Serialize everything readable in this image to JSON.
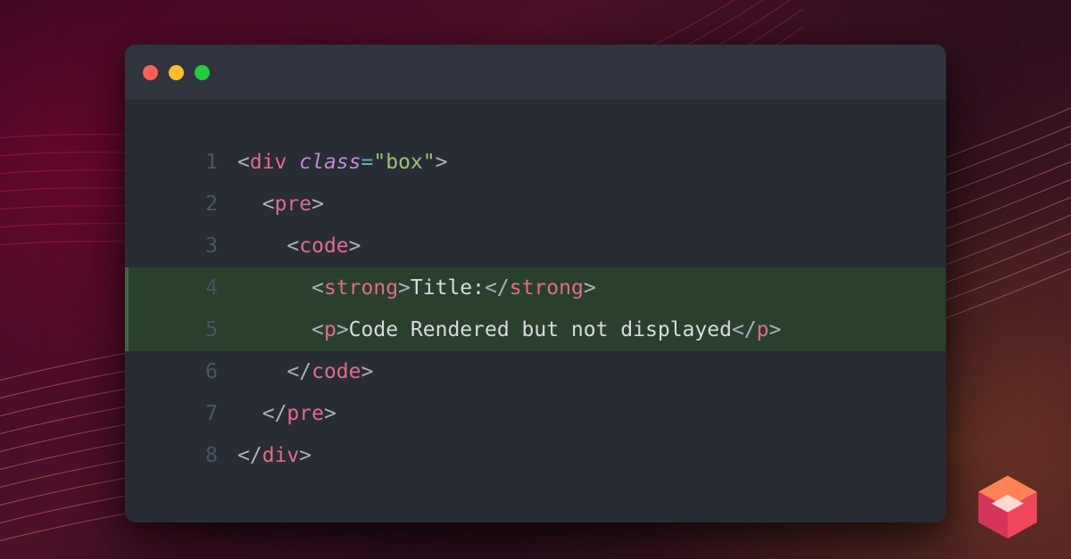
{
  "editor": {
    "traffic_lights": [
      "close",
      "minimize",
      "maximize"
    ],
    "line_numbers": [
      "1",
      "2",
      "3",
      "4",
      "5",
      "6",
      "7",
      "8"
    ],
    "highlighted_lines": [
      4,
      5
    ],
    "lines": [
      {
        "indent": 0,
        "open": true,
        "tag": "div",
        "attr": "class",
        "value": "\"box\"",
        "close_slash": false
      },
      {
        "indent": 1,
        "open": true,
        "tag": "pre",
        "close_slash": false
      },
      {
        "indent": 2,
        "open": true,
        "tag": "code",
        "close_slash": false
      },
      {
        "indent": 3,
        "wrap": "strong",
        "text": "Title:"
      },
      {
        "indent": 3,
        "wrap": "p",
        "text": "Code Rendered but not displayed"
      },
      {
        "indent": 2,
        "open": false,
        "tag": "code",
        "close_slash": true
      },
      {
        "indent": 1,
        "open": false,
        "tag": "pre",
        "close_slash": true
      },
      {
        "indent": 0,
        "open": false,
        "tag": "div",
        "close_slash": true
      }
    ],
    "tokens": {
      "lt": "<",
      "gt": ">",
      "slash": "/",
      "eq": "="
    }
  },
  "brand": {
    "name": "logo-cube"
  }
}
